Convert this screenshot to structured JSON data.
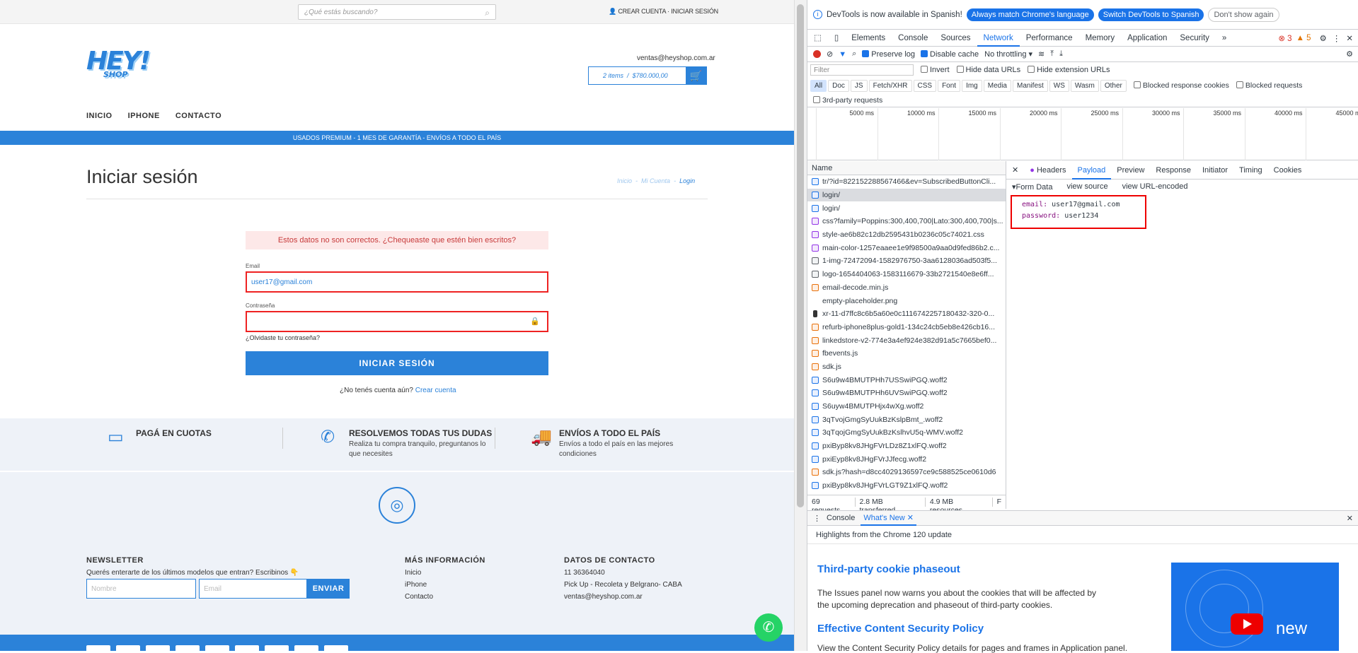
{
  "site": {
    "search_placeholder": "¿Qué estás buscando?",
    "create_account": "CREAR CUENTA",
    "sep": "·",
    "sign_in": "INICIAR SESIÓN",
    "logo_main": "HEY!",
    "logo_sub": "SHOP",
    "email_contact": "ventas@heyshop.com.ar",
    "cart_items": "2 items",
    "cart_sep": "/",
    "cart_total": "$780.000,00",
    "nav": [
      "INICIO",
      "IPHONE",
      "CONTACTO"
    ],
    "promo": "USADOS PREMIUM - 1 MES DE GARANTÍA - ENVÍOS A TODO EL PAÍS",
    "page_title": "Iniciar sesión",
    "crumbs": [
      "Inicio",
      "-",
      "Mi Cuenta",
      "-",
      "Login"
    ],
    "error": "Estos datos no son correctos. ¿Chequeaste que estén bien escritos?",
    "email_label": "Email",
    "email_value": "user17@gmail.com",
    "password_label": "Contraseña",
    "forgot": "¿Olvidaste tu contraseña?",
    "login_button": "INICIAR SESIÓN",
    "no_account": "¿No tenés cuenta aún?",
    "create_link": "Crear cuenta",
    "features": [
      {
        "title": "PAGÁ EN CUOTAS",
        "desc": "",
        "icon": "credit-card-icon"
      },
      {
        "title": "RESOLVEMOS TODAS TUS DUDAS",
        "desc": "Realiza tu compra tranquilo, preguntanos lo que necesites",
        "icon": "whatsapp-icon"
      },
      {
        "title": "ENVÍOS A TODO EL PAÍS",
        "desc": "Envíos a todo el país en las mejores condiciones",
        "icon": "truck-icon"
      }
    ],
    "newsletter_title": "NEWSLETTER",
    "newsletter_text": "Querés enterarte de los últimos modelos que entran? Escribinos 👇",
    "name_placeholder": "Nombre",
    "email_placeholder": "Email",
    "send": "ENVIAR",
    "more_title": "MÁS INFORMACIÓN",
    "more_links": [
      "Inicio",
      "iPhone",
      "Contacto"
    ],
    "contact_title": "DATOS DE CONTACTO",
    "contact_lines": [
      "11 36364040",
      "Pick Up - Recoleta y Belgrano- CABA",
      "ventas@heyshop.com.ar"
    ],
    "accent": "#2b82d9"
  },
  "devtools": {
    "info_text": "DevTools is now available in Spanish!",
    "btn_match": "Always match Chrome's language",
    "btn_switch": "Switch DevTools to Spanish",
    "btn_dont": "Don't show again",
    "tabs": [
      "Elements",
      "Console",
      "Sources",
      "Network",
      "Performance",
      "Memory",
      "Application",
      "Security",
      "»"
    ],
    "errors": "3",
    "warnings": "5",
    "preserve_log": "Preserve log",
    "disable_cache": "Disable cache",
    "throttling": "No throttling",
    "filter_placeholder": "Filter",
    "invert": "Invert",
    "hide_data": "Hide data URLs",
    "hide_ext": "Hide extension URLs",
    "types": [
      "All",
      "Doc",
      "JS",
      "Fetch/XHR",
      "CSS",
      "Font",
      "Img",
      "Media",
      "Manifest",
      "WS",
      "Wasm",
      "Other"
    ],
    "blocked_cookies": "Blocked response cookies",
    "blocked_requests": "Blocked requests",
    "third_party": "3rd-party requests",
    "ticks": [
      "5000 ms",
      "10000 ms",
      "15000 ms",
      "20000 ms",
      "25000 ms",
      "30000 ms",
      "35000 ms",
      "40000 ms",
      "45000 ms"
    ],
    "name_header": "Name",
    "requests": [
      {
        "name": "tr/?id=822152288567466&ev=SubscribedButtonCli...",
        "type": "doc"
      },
      {
        "name": "login/",
        "type": "doc"
      },
      {
        "name": "login/",
        "type": "doc"
      },
      {
        "name": "css?family=Poppins:300,400,700|Lato:300,400,700|s...",
        "type": "css"
      },
      {
        "name": "style-ae6b82c12db2595431b0236c05c74021.css",
        "type": "css"
      },
      {
        "name": "main-color-1257eaaee1e9f98500a9aa0d9fed86b2.c...",
        "type": "css"
      },
      {
        "name": "1-img-72472094-1582976750-3aa6128036ad503f5...",
        "type": "img"
      },
      {
        "name": "logo-1654404063-1583116679-33b2721540e8e6ff...",
        "type": "img"
      },
      {
        "name": "email-decode.min.js",
        "type": "js"
      },
      {
        "name": "empty-placeholder.png",
        "type": "blank"
      },
      {
        "name": "xr-11-d7ffc8c6b5a60e0c1116742257180432-320-0...",
        "type": "other"
      },
      {
        "name": "refurb-iphone8plus-gold1-134c24cb5eb8e426cb16...",
        "type": "js"
      },
      {
        "name": "linkedstore-v2-774e3a4ef924e382d91a5c7665bef0...",
        "type": "js"
      },
      {
        "name": "fbevents.js",
        "type": "js"
      },
      {
        "name": "sdk.js",
        "type": "js"
      },
      {
        "name": "S6u9w4BMUTPHh7USSwiPGQ.woff2",
        "type": "font"
      },
      {
        "name": "S6u9w4BMUTPHh6UVSwiPGQ.woff2",
        "type": "font"
      },
      {
        "name": "S6uyw4BMUTPHjx4wXg.woff2",
        "type": "font"
      },
      {
        "name": "3qTvojGmgSyUukBzKslpBmt_.woff2",
        "type": "font"
      },
      {
        "name": "3qTqojGmgSyUukBzKslhvU5q-WMV.woff2",
        "type": "font"
      },
      {
        "name": "pxiByp8kv8JHgFVrLDz8Z1xlFQ.woff2",
        "type": "font"
      },
      {
        "name": "pxiEyp8kv8JHgFVrJJfecg.woff2",
        "type": "font"
      },
      {
        "name": "sdk.js?hash=d8cc4029136597ce9c588525ce0610d6",
        "type": "js"
      },
      {
        "name": "pxiByp8kv8JHgFVrLGT9Z1xlFQ.woff2",
        "type": "font"
      }
    ],
    "status_requests": "69 requests",
    "status_transferred": "2.8 MB transferred",
    "status_resources": "4.9 MB resources",
    "status_more": "F",
    "detail_tabs": [
      "Headers",
      "Payload",
      "Preview",
      "Response",
      "Initiator",
      "Timing",
      "Cookies"
    ],
    "form_data": "▾Form Data",
    "view_source": "view source",
    "view_url": "view URL-encoded",
    "payload": [
      {
        "key": "email:",
        "value": "user17@gmail.com"
      },
      {
        "key": "password:",
        "value": "user1234"
      }
    ],
    "drawer_tabs": [
      "Console",
      "What's New"
    ],
    "whats_new_sub": "Highlights from the Chrome 120 update",
    "wn_h1": "Third-party cookie phaseout",
    "wn_p": "The Issues panel now warns you about the cookies that will be affected by the upcoming deprecation and phaseout of third-party cookies.",
    "wn_h2": "Effective Content Security Policy",
    "wn_p2": "View the Content Security Policy details for pages and frames in Application panel.",
    "wn_img_text": "new"
  }
}
